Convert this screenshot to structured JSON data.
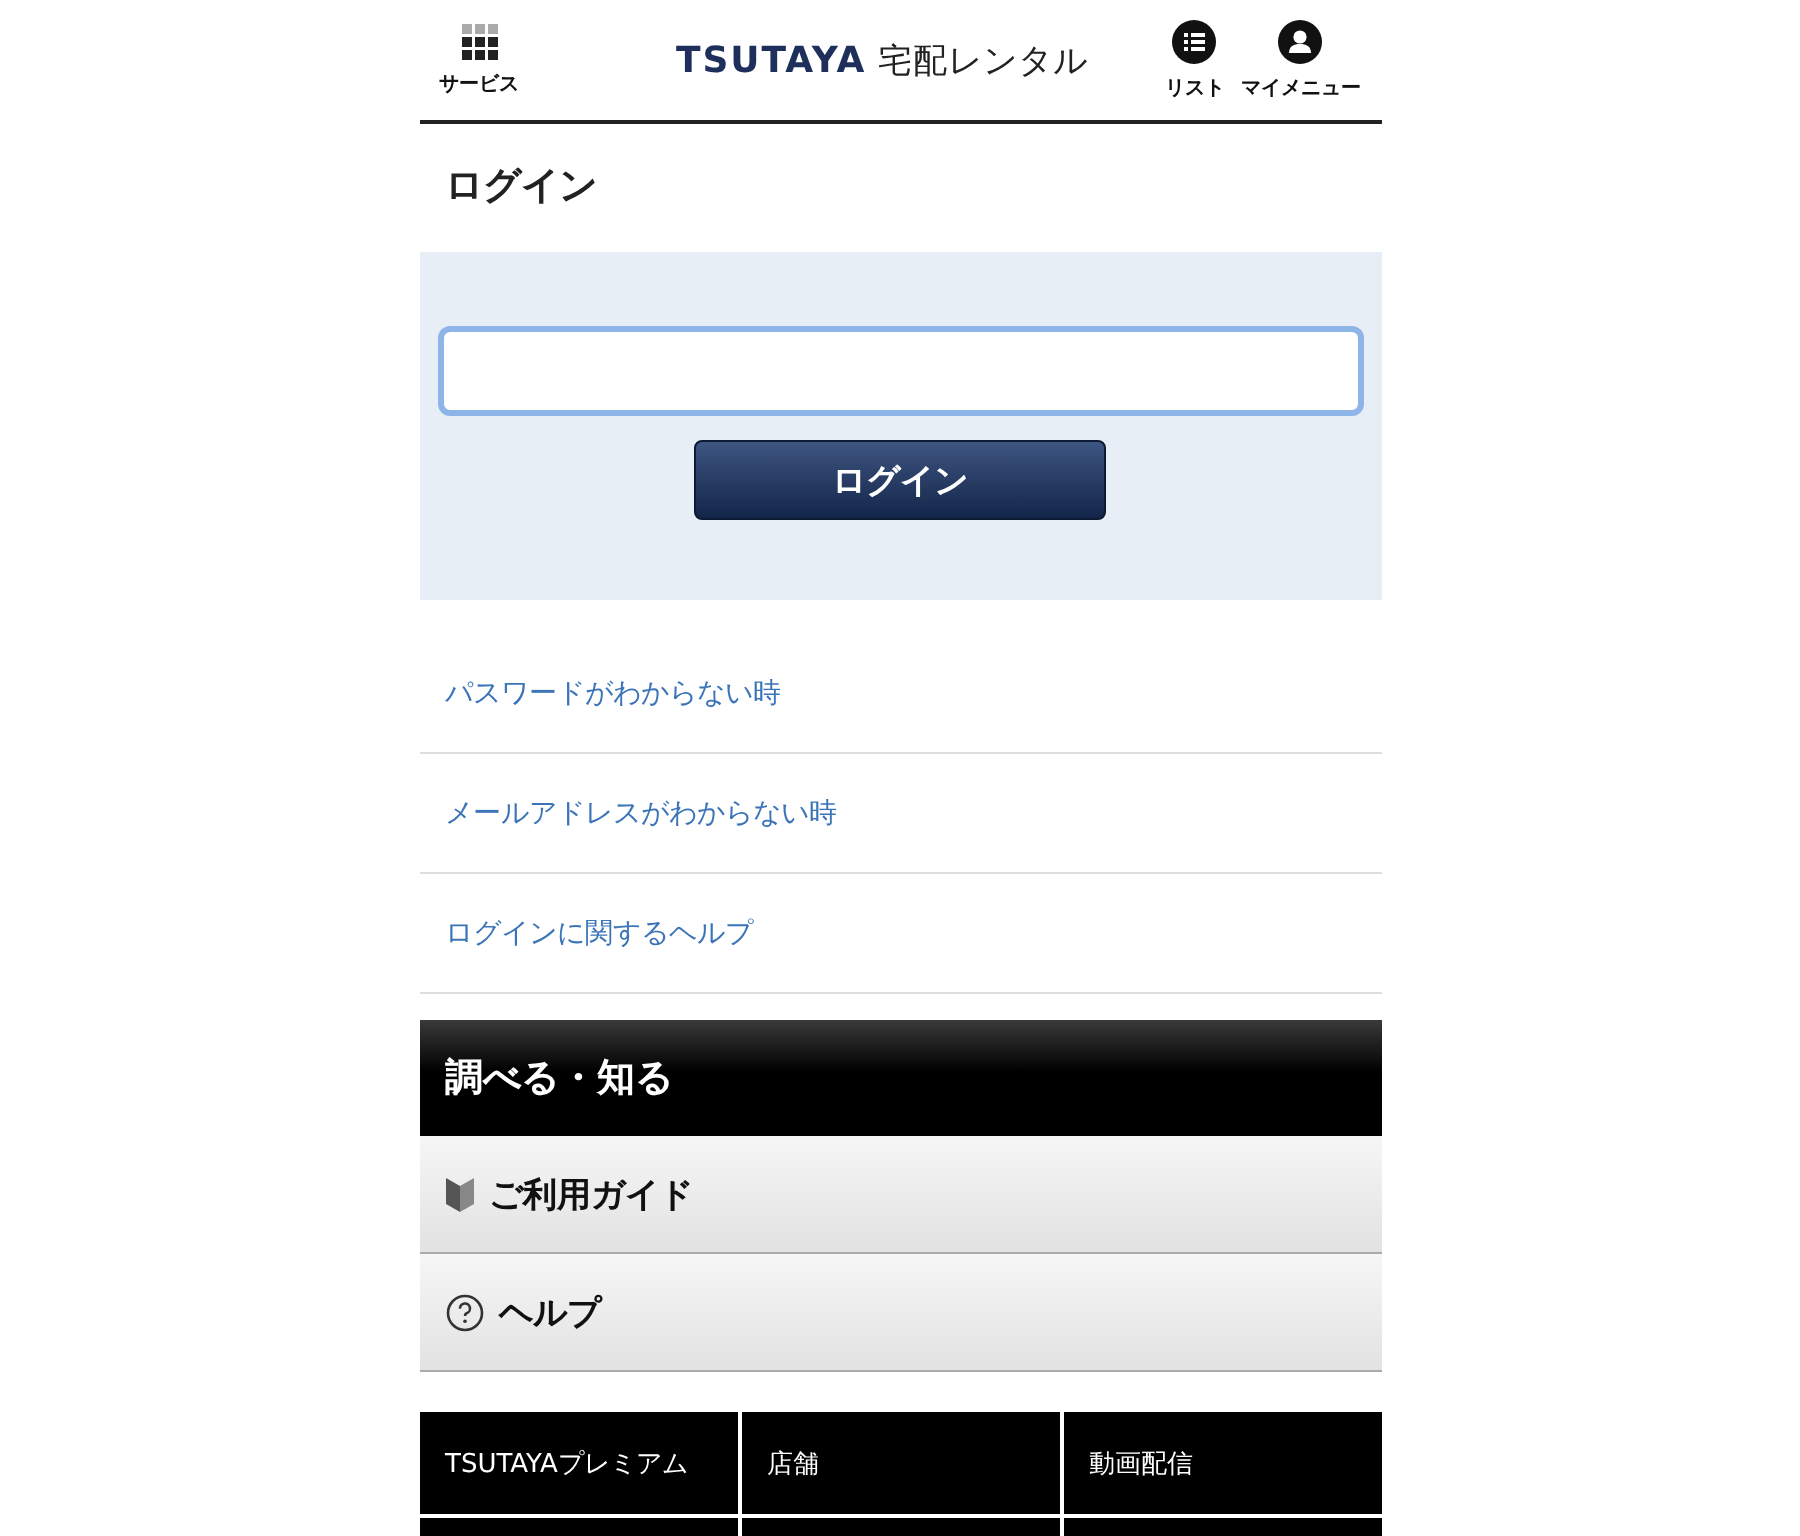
{
  "header": {
    "left": {
      "label": "サービス"
    },
    "logo": "**TSUTAYA** 宅配レンタル",
    "right": [
      {
        "kind": "list",
        "label": "リスト"
      },
      {
        "kind": "user",
        "label": "マイメニュー"
      }
    ]
  },
  "page_title": "ログイン",
  "login_form": {
    "button": "ログイン"
  },
  "links": [
    "パスワードがわからない時",
    "メールアドレスがわからない時",
    "ログインに関するヘルプ"
  ],
  "section": {
    "title": "調べる・知る",
    "items": [
      {
        "kind": "guide",
        "label": "ご利用ガイド"
      },
      {
        "kind": "help",
        "label": "ヘルプ"
      }
    ]
  },
  "footer": {
    "rows": [
      [
        "TSUTAYAプレミアム",
        "店舗",
        "動画配信"
      ]
    ]
  }
}
